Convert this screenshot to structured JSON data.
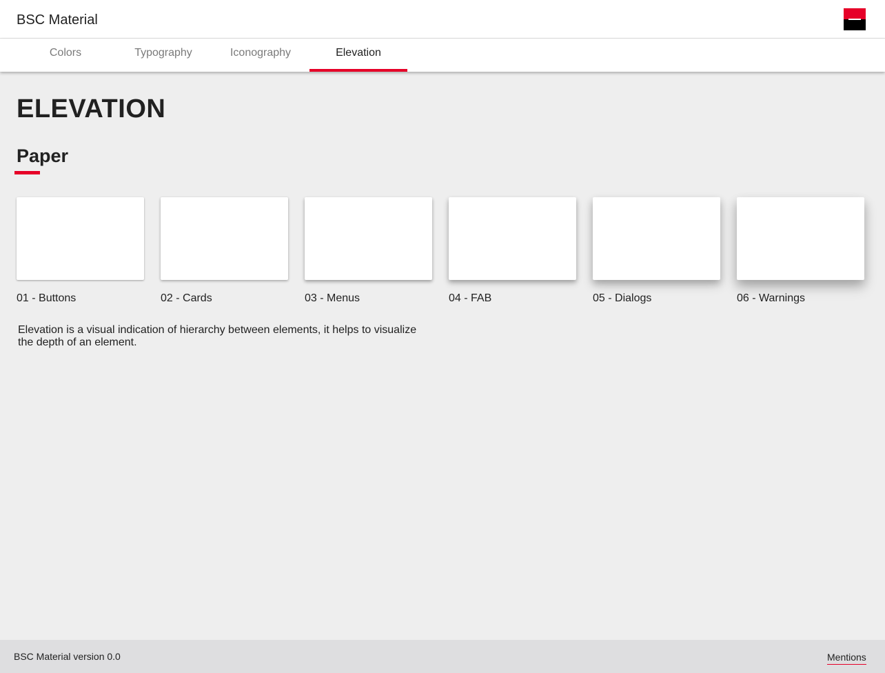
{
  "header": {
    "app_title": "BSC Material",
    "logo_icon": "societe-generale-logo-icon",
    "brand_red": "#e60028",
    "brand_black": "#000000"
  },
  "tabs": [
    {
      "label": "Colors",
      "active": false
    },
    {
      "label": "Typography",
      "active": false
    },
    {
      "label": "Iconography",
      "active": false
    },
    {
      "label": "Elevation",
      "active": true
    }
  ],
  "main": {
    "page_title": "ELEVATION",
    "section_title": "Paper",
    "papers": [
      {
        "label": "01 - Buttons"
      },
      {
        "label": "02 - Cards"
      },
      {
        "label": "03 - Menus"
      },
      {
        "label": "04 - FAB"
      },
      {
        "label": "05 - Dialogs"
      },
      {
        "label": "06 - Warnings"
      }
    ],
    "description": "Elevation is a visual indication of hierarchy between elements, it helps to visualize the depth of an element."
  },
  "footer": {
    "version": "BSC Material version 0.0",
    "mentions_label": "Mentions"
  }
}
